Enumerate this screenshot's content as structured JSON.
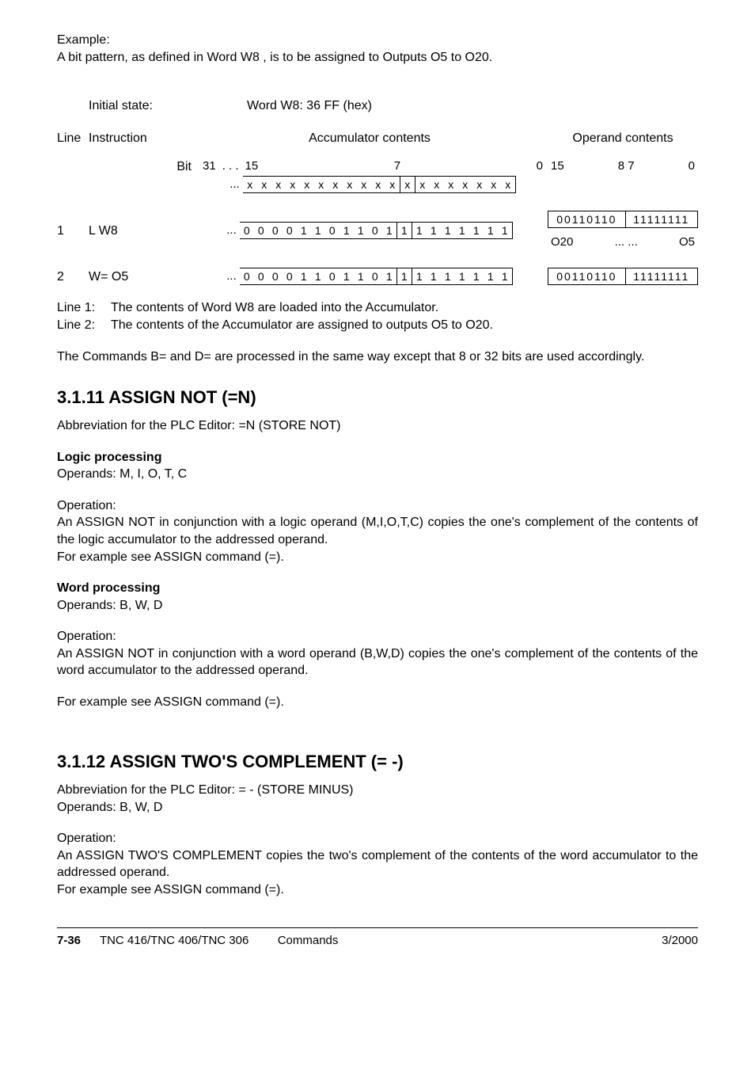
{
  "intro": {
    "example_label": "Example:",
    "example_text": "A bit pattern, as defined in Word  W8 , is to be assigned to Outputs O5 to O20."
  },
  "diagram": {
    "initial_state_label": "Initial state:",
    "word_def": "Word  W8:   36 FF    (hex)",
    "hdr_line": "Line",
    "hdr_instruction": "Instruction",
    "hdr_accum": "Accumulator contents",
    "hdr_operand": "Operand contents",
    "bit_label": "Bit",
    "accum_bits": {
      "b31": "31",
      "dots": ".   .   .",
      "b15": "15",
      "b7": "7",
      "b0": "0"
    },
    "oper_bits": {
      "b15": "15",
      "b87": "8 7",
      "b0": "0"
    },
    "accum_mask_prefix": "...",
    "accum_mask_cells": [
      "x",
      "x",
      "x",
      "x",
      "x",
      "x",
      "x",
      "x",
      "x",
      "x",
      "x",
      "x",
      "x",
      "x",
      "x",
      "x",
      "x",
      "x",
      "x"
    ],
    "rows": [
      {
        "num": "1",
        "instr": "L   W8",
        "accum_prefix": "...",
        "accum_cells": [
          "0",
          "0",
          "0",
          "0",
          "1",
          "1",
          "0",
          "1",
          "1",
          "0",
          "1",
          "1",
          "1",
          "1",
          "1",
          "1",
          "1",
          "1",
          "1"
        ],
        "oper_left": "00110110",
        "oper_right": "11111111",
        "outputs_left": "O20",
        "outputs_mid": "...  ...",
        "outputs_right": "O5"
      },
      {
        "num": "2",
        "instr": "W=  O5",
        "accum_prefix": "...",
        "accum_cells": [
          "0",
          "0",
          "0",
          "0",
          "1",
          "1",
          "0",
          "1",
          "1",
          "0",
          "1",
          "1",
          "1",
          "1",
          "1",
          "1",
          "1",
          "1",
          "1"
        ],
        "oper_left": "00110110",
        "oper_right": "11111111"
      }
    ],
    "line1_label": "Line 1:",
    "line1_text": "The contents of Word W8 are loaded into the Accumulator.",
    "line2_label": "Line 2:",
    "line2_text": "The contents of the Accumulator are assigned to outputs O5 to O20.",
    "note": "The Commands B=  and D= are processed in the same way except that 8 or 32 bits are used accordingly."
  },
  "sec11": {
    "heading": "3.1.11   ASSIGN NOT (=N)",
    "abbrev": "Abbreviation for the PLC Editor: =N (STORE NOT)",
    "logic_hdr": "Logic processing",
    "logic_operands": "Operands: M, I, O, T, C",
    "logic_operation_label": "Operation:",
    "logic_operation_text": "An ASSIGN NOT in conjunction with a logic operand (M,I,O,T,C) copies the one's complement of the contents of the logic accumulator to the addressed operand.",
    "logic_example": "For example see ASSIGN command (=).",
    "word_hdr": "Word processing",
    "word_operands": "Operands: B, W, D",
    "word_operation_label": "Operation:",
    "word_operation_text": "An ASSIGN NOT in conjunction with a word operand (B,W,D) copies the one's complement of the contents of the word accumulator to the addressed operand.",
    "word_example": "For example see ASSIGN command (=)."
  },
  "sec12": {
    "heading": "3.1.12   ASSIGN TWO'S COMPLEMENT (= -)",
    "abbrev": "Abbreviation for the PLC Editor: = - (STORE MINUS)",
    "operands": "Operands: B, W, D",
    "operation_label": "Operation:",
    "operation_text": "An ASSIGN TWO'S COMPLEMENT copies the two's complement of the contents of the word accumulator to the addressed operand.",
    "example": "For example see ASSIGN command (=)."
  },
  "footer": {
    "page": "7-36",
    "model": "TNC 416/TNC 406/TNC 306",
    "section": "Commands",
    "date": "3/2000"
  }
}
